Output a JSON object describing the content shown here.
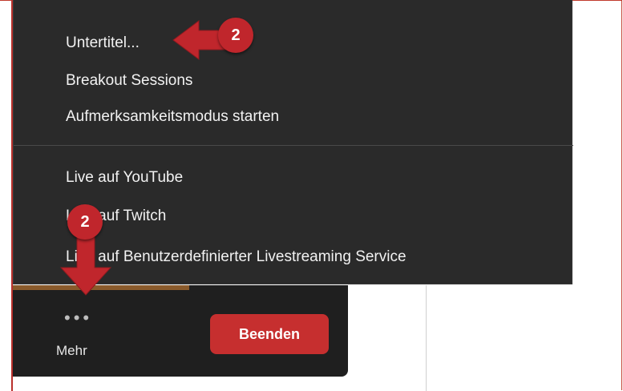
{
  "menu": {
    "items": [
      {
        "label": "Untertitel..."
      },
      {
        "label": "Breakout Sessions"
      },
      {
        "label": "Aufmerksamkeitsmodus starten"
      },
      {
        "label": "Live auf YouTube"
      },
      {
        "label": "Live auf Twitch"
      },
      {
        "label": "Live auf Benutzerdefinierter Livestreaming Service"
      }
    ]
  },
  "toolbar": {
    "more_dots": "•••",
    "more_label": "Mehr",
    "end_label": "Beenden"
  },
  "annotations": {
    "badge_top": "2",
    "badge_bottom": "2"
  },
  "colors": {
    "accent_red": "#c62f2f",
    "menu_bg": "#2a2a2a"
  }
}
